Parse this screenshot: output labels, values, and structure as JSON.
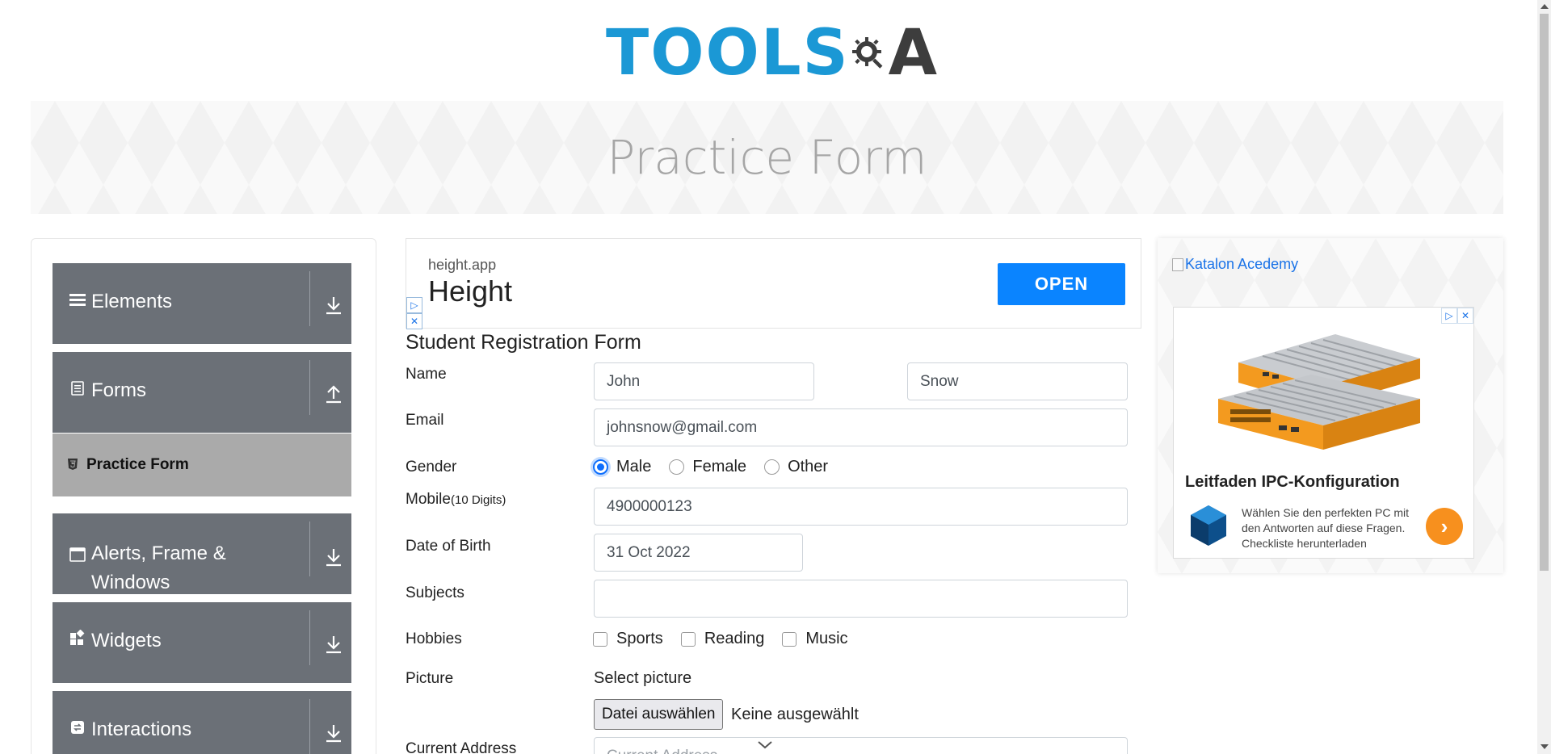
{
  "header": {
    "logo_tools": "TOOLS",
    "logo_qa": "A"
  },
  "banner": {
    "title": "Practice Form"
  },
  "sidebar": {
    "groups": [
      {
        "label": "Elements",
        "icon": "hamburger-icon",
        "arrow": "download-arrow-icon"
      },
      {
        "label": "Forms",
        "icon": "document-icon",
        "arrow": "upload-arrow-icon"
      },
      {
        "label": "Alerts, Frame &",
        "label2": "Windows",
        "icon": "window-icon",
        "arrow": "download-arrow-icon"
      },
      {
        "label": "Widgets",
        "icon": "widgets-icon",
        "arrow": "download-arrow-icon"
      },
      {
        "label": "Interactions",
        "icon": "interactions-icon",
        "arrow": "download-arrow-icon"
      }
    ],
    "active_item": "Practice Form"
  },
  "ad_top": {
    "domain": "height.app",
    "brand": "Height",
    "cta": "OPEN",
    "badge_play": "▷",
    "badge_close": "✕"
  },
  "form": {
    "title": "Student Registration Form",
    "name_label": "Name",
    "first_name": "John",
    "last_name": "Snow",
    "email_label": "Email",
    "email": "johnsnow@gmail.com",
    "gender_label": "Gender",
    "gender_options": [
      "Male",
      "Female",
      "Other"
    ],
    "gender_selected": "Male",
    "mobile_label": "Mobile",
    "mobile_hint": "(10 Digits)",
    "mobile": "4900000123",
    "dob_label": "Date of Birth",
    "dob": "31 Oct 2022",
    "subjects_label": "Subjects",
    "subjects": "",
    "hobbies_label": "Hobbies",
    "hobbies": [
      "Sports",
      "Reading",
      "Music"
    ],
    "picture_label": "Picture",
    "select_picture": "Select picture",
    "file_button": "Datei auswählen",
    "file_status": "Keine ausgewählt",
    "address_label": "Current Address",
    "address_placeholder": "Current Address"
  },
  "ad_right": {
    "katalon_alt": "Katalon Acedemy",
    "title": "Leitfaden IPC-Konfiguration",
    "text": "Wählen Sie den perfekten PC mit den Antworten auf diese Fragen. Checkliste herunterladen",
    "go": "›",
    "badge_play": "▷",
    "badge_close": "✕"
  },
  "colors": {
    "sidebar_bg": "#6b7077",
    "active_item_bg": "#aaaaaa",
    "cta_blue": "#0a84ff",
    "logo_blue": "#1b98d5",
    "radio_blue": "#0d6efd",
    "ipc_orange": "#f7901e"
  }
}
